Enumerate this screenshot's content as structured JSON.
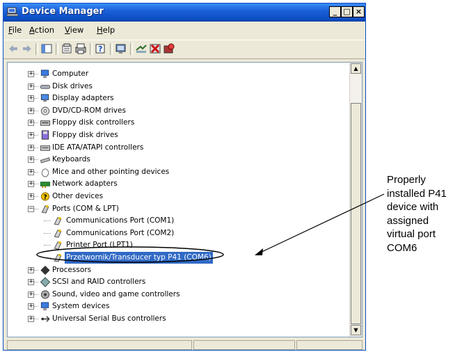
{
  "window": {
    "title": "Device Manager",
    "buttons": [
      "_",
      "□",
      "×"
    ]
  },
  "menu": [
    {
      "label": "File",
      "accel": "F"
    },
    {
      "label": "Action",
      "accel": "A"
    },
    {
      "label": "View",
      "accel": "V"
    },
    {
      "label": "Help",
      "accel": "H"
    }
  ],
  "toolbar": {
    "icons": [
      "back-arrow-icon",
      "forward-arrow-icon",
      "console-tree-icon",
      "properties-icon",
      "print-icon",
      "help-icon",
      "scan-hardware-icon",
      "update-driver-icon",
      "uninstall-icon",
      "disable-device-icon"
    ]
  },
  "tree": {
    "items": [
      {
        "label": "Computer",
        "icon": "computer-icon",
        "expander": "+"
      },
      {
        "label": "Disk drives",
        "icon": "disk-drive-icon",
        "expander": "+"
      },
      {
        "label": "Display adapters",
        "icon": "display-adapter-icon",
        "expander": "+"
      },
      {
        "label": "DVD/CD-ROM drives",
        "icon": "dvd-icon",
        "expander": "+"
      },
      {
        "label": "Floppy disk controllers",
        "icon": "floppy-controller-icon",
        "expander": "+"
      },
      {
        "label": "Floppy disk drives",
        "icon": "floppy-drive-icon",
        "expander": "+"
      },
      {
        "label": "IDE ATA/ATAPI controllers",
        "icon": "ide-controller-icon",
        "expander": "+"
      },
      {
        "label": "Keyboards",
        "icon": "keyboard-icon",
        "expander": "+"
      },
      {
        "label": "Mice and other pointing devices",
        "icon": "mouse-icon",
        "expander": "+"
      },
      {
        "label": "Network adapters",
        "icon": "network-adapter-icon",
        "expander": "+"
      },
      {
        "label": "Other devices",
        "icon": "other-devices-icon",
        "expander": "+"
      },
      {
        "label": "Ports (COM & LPT)",
        "icon": "ports-icon",
        "expander": "−"
      },
      {
        "label": "Communications Port (COM1)",
        "icon": "port-icon",
        "child": true
      },
      {
        "label": "Communications Port (COM2)",
        "icon": "port-icon",
        "child": true
      },
      {
        "label": "Printer Port (LPT1)",
        "icon": "port-icon",
        "child": true
      },
      {
        "label": "Przetwornik/Transducer typ P41 (COM6)",
        "icon": "port-icon",
        "child": true,
        "selected": true
      },
      {
        "label": "Processors",
        "icon": "processor-icon",
        "expander": "+"
      },
      {
        "label": "SCSI and RAID controllers",
        "icon": "scsi-icon",
        "expander": "+"
      },
      {
        "label": "Sound, video and game controllers",
        "icon": "sound-icon",
        "expander": "+"
      },
      {
        "label": "System devices",
        "icon": "system-device-icon",
        "expander": "+"
      },
      {
        "label": "Universal Serial Bus controllers",
        "icon": "usb-icon",
        "expander": "+"
      }
    ]
  },
  "callout": {
    "lines": [
      "Properly",
      "installed P41",
      "device with",
      "assigned",
      "virtual port",
      "COM6"
    ]
  },
  "colors": {
    "title_bar": "#0b4ec3",
    "selection": "#316ac5",
    "window_bg": "#ece9d8"
  }
}
